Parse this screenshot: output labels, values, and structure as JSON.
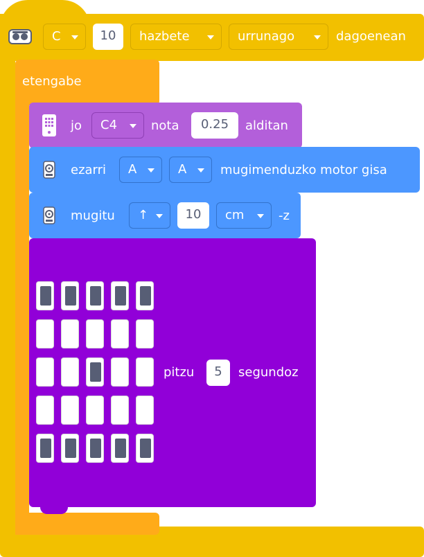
{
  "hat_block": {
    "color": "#f2c000",
    "icon": "robot-eyes-icon",
    "port": "C",
    "distance": "10",
    "unit": "hazbete",
    "comparison": "urrunago",
    "suffix": "dagoenean"
  },
  "forever_block": {
    "color": "#ffab19",
    "label": "etengabe"
  },
  "play_note_block": {
    "color": "#b35fda",
    "icon": "speaker-icon",
    "prefix": "jo",
    "note": "C4",
    "note_label": "nota",
    "duration": "0.25",
    "suffix": "alditan"
  },
  "set_motor_block": {
    "color": "#4c97ff",
    "icon": "motor-icon",
    "prefix": "ezarri",
    "port_a": "A",
    "port_b": "A",
    "suffix": "mugimenduzko motor gisa"
  },
  "move_block": {
    "color": "#4c97ff",
    "icon": "motor-icon",
    "prefix": "mugitu",
    "direction": "↑",
    "distance": "10",
    "unit": "cm",
    "suffix": "-z"
  },
  "light_block": {
    "color": "#9100d8",
    "matrix": [
      [
        1,
        1,
        1,
        1,
        1
      ],
      [
        0,
        0,
        0,
        0,
        0
      ],
      [
        0,
        0,
        1,
        0,
        0
      ],
      [
        0,
        0,
        0,
        0,
        0
      ],
      [
        1,
        1,
        1,
        1,
        1
      ]
    ],
    "label": "pitzu",
    "seconds": "5",
    "suffix": "segundoz"
  }
}
